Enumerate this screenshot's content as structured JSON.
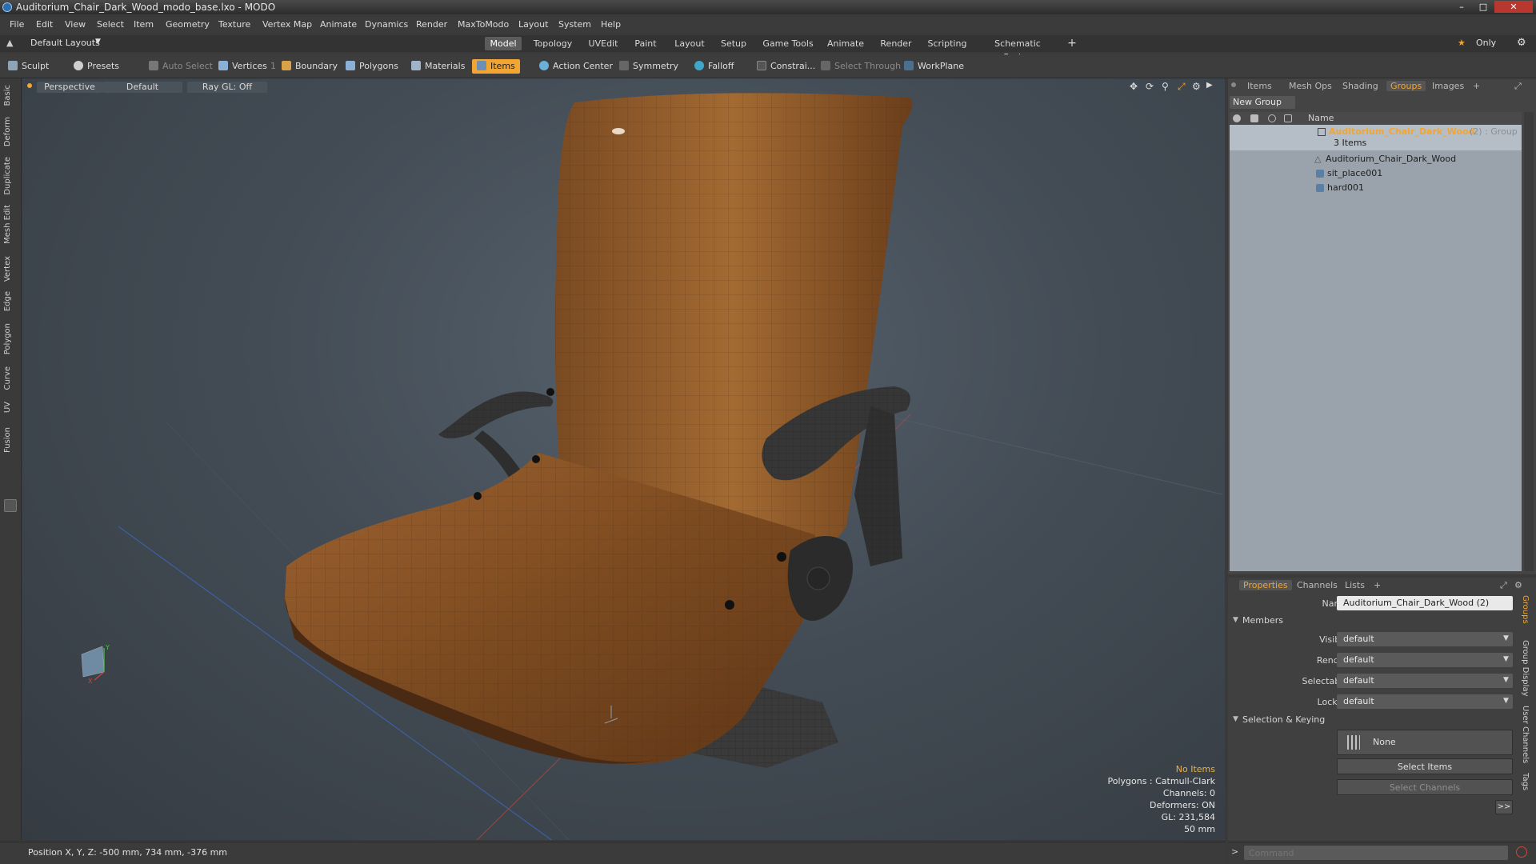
{
  "window": {
    "title": "Auditorium_Chair_Dark_Wood_modo_base.lxo - MODO"
  },
  "menu": [
    "File",
    "Edit",
    "View",
    "Select",
    "Item",
    "Geometry",
    "Texture",
    "Vertex Map",
    "Animate",
    "Dynamics",
    "Render",
    "MaxToModo",
    "Layout",
    "System",
    "Help"
  ],
  "layout_selector": "Default Layouts",
  "mode_tabs": [
    "Model",
    "Topology",
    "UVEdit",
    "Paint",
    "Layout",
    "Setup",
    "Game Tools",
    "Animate",
    "Render",
    "Scripting",
    "Schematic Fusion"
  ],
  "only_label": "Only",
  "toolbar": {
    "sculpt": "Sculpt",
    "presets": "Presets",
    "auto_select": "Auto Select",
    "vertices": "Vertices",
    "vertices_count": "1",
    "boundary": "Boundary",
    "polygons": "Polygons",
    "materials": "Materials",
    "items": "Items",
    "action_center": "Action Center",
    "symmetry": "Symmetry",
    "falloff": "Falloff",
    "constraints": "Constrai...",
    "select_through": "Select Through",
    "workplane": "WorkPlane"
  },
  "left_tabs": [
    "Basic",
    "Deform",
    "Duplicate",
    "Mesh Edit",
    "Vertex",
    "Edge",
    "Polygon",
    "Curve",
    "UV",
    "Fusion"
  ],
  "viewport": {
    "view": "Perspective",
    "shading": "Default",
    "raygl": "Ray GL: Off",
    "info": {
      "no_items": "No Items",
      "polygons": "Polygons : Catmull-Clark",
      "channels": "Channels: 0",
      "deformers": "Deformers: ON",
      "gl": "GL: 231,584",
      "scale": "50 mm"
    }
  },
  "status": {
    "position": "Position X, Y, Z:  -500 mm, 734 mm, -376 mm"
  },
  "top_panel": {
    "tabs": [
      "Items",
      "Mesh Ops",
      "Shading",
      "Groups",
      "Images"
    ],
    "active_tab": "Groups",
    "new_group": "New Group",
    "column_name": "Name",
    "group": {
      "name": "Auditorium_Chair_Dark_Wood",
      "suffix": "(2) : Group",
      "count": "3 Items"
    },
    "children": [
      "Auditorium_Chair_Dark_Wood",
      "sit_place001",
      "hard001"
    ]
  },
  "bottom_panel": {
    "tabs": [
      "Properties",
      "Channels",
      "Lists"
    ],
    "active_tab": "Properties",
    "name_label": "Name",
    "name_value": "Auditorium_Chair_Dark_Wood (2)",
    "members_section": "Members",
    "fields": [
      {
        "label": "Visible",
        "value": "default"
      },
      {
        "label": "Render",
        "value": "default"
      },
      {
        "label": "Selectable",
        "value": "default"
      },
      {
        "label": "Locked",
        "value": "default"
      }
    ],
    "selection_section": "Selection & Keying",
    "none_btn": "None",
    "select_items": "Select Items",
    "select_channels": "Select Channels",
    "more": ">>",
    "side_tabs": [
      "Groups",
      "Group Display",
      "User Channels",
      "Tags"
    ]
  },
  "command": {
    "placeholder": "Command"
  },
  "colors": {
    "accent": "#f2a531",
    "panel": "#444444",
    "wood": "#8a5324"
  }
}
